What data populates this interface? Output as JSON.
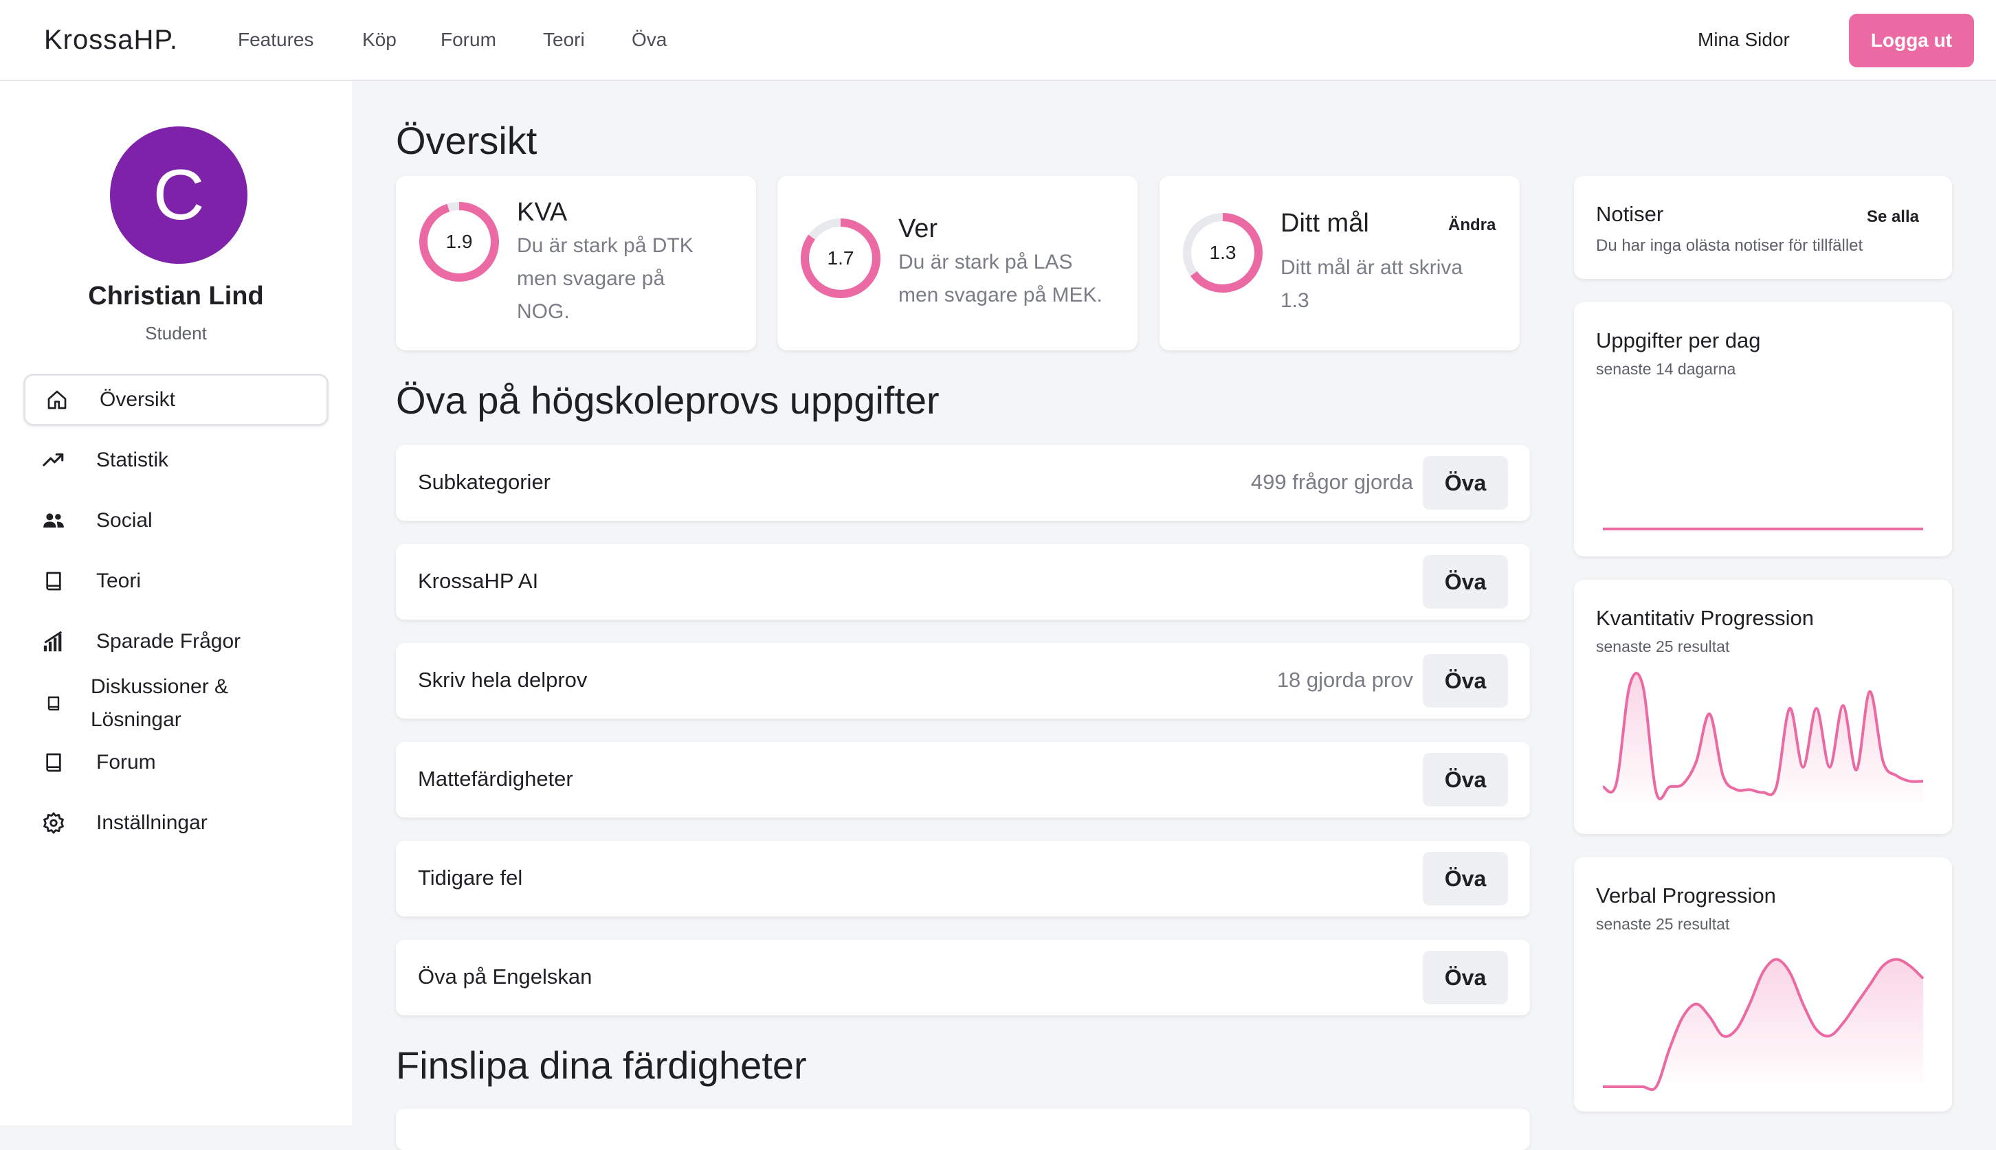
{
  "nav": {
    "brand": "KrossaHP.",
    "links": [
      "Features",
      "Köp",
      "Forum",
      "Teori",
      "Öva"
    ],
    "mina_sidor": "Mina Sidor",
    "logout": "Logga ut",
    "accent": "#ec6aa3"
  },
  "profile": {
    "initial": "C",
    "name": "Christian Lind",
    "role": "Student",
    "avatar_color": "#7e22a9"
  },
  "sidebar": {
    "items": [
      {
        "label": "Översikt",
        "icon": "home-icon",
        "active": true
      },
      {
        "label": "Statistik",
        "icon": "trending-up-icon"
      },
      {
        "label": "Social",
        "icon": "users-icon"
      },
      {
        "label": "Teori",
        "icon": "book-icon"
      },
      {
        "label": "Sparade Frågor",
        "icon": "signal-bars-icon"
      },
      {
        "label": "Diskussioner & Lösningar",
        "icon": "book-small-icon"
      },
      {
        "label": "Forum",
        "icon": "book-icon"
      },
      {
        "label": "Inställningar",
        "icon": "gear-icon"
      }
    ]
  },
  "main": {
    "overview_title": "Översikt",
    "stats": [
      {
        "title": "KVA",
        "value": "1.9",
        "fraction": 0.95,
        "desc_lines": [
          "Du är stark på DTK",
          "men svagare på",
          "NOG."
        ]
      },
      {
        "title": "Ver",
        "value": "1.7",
        "fraction": 0.85,
        "desc_lines": [
          "Du är stark på LAS",
          "men svagare på MEK."
        ]
      },
      {
        "title": "Ditt mål",
        "value": "1.3",
        "fraction": 0.65,
        "desc_lines": [
          "Ditt mål är att skriva",
          "1.3"
        ],
        "action": "Ändra"
      }
    ],
    "practice_title": "Öva på högskoleprovs uppgifter",
    "practice_rows": [
      {
        "label": "Subkategorier",
        "meta": "499 frågor gjorda",
        "button": "Öva"
      },
      {
        "label": "KrossaHP AI",
        "meta": "",
        "button": "Öva"
      },
      {
        "label": "Skriv hela delprov",
        "meta": "18 gjorda prov",
        "button": "Öva"
      },
      {
        "label": "Mattefärdigheter",
        "meta": "",
        "button": "Öva"
      },
      {
        "label": "Tidigare fel",
        "meta": "",
        "button": "Öva"
      },
      {
        "label": "Öva på Engelskan",
        "meta": "",
        "button": "Öva"
      }
    ],
    "skills_title": "Finslipa dina färdigheter"
  },
  "right": {
    "notices": {
      "title": "Notiser",
      "action": "Se alla",
      "text": "Du har inga olästa notiser för tillfället"
    },
    "per_day": {
      "title": "Uppgifter per dag",
      "subtitle": "senaste 14 dagarna"
    },
    "quant": {
      "title": "Kvantitativ Progression",
      "subtitle": "senaste 25 resultat"
    },
    "verbal": {
      "title": "Verbal Progression",
      "subtitle": "senaste 25 resultat"
    }
  },
  "chart_data": [
    {
      "type": "line",
      "title": "Uppgifter per dag",
      "x": [
        1,
        2,
        3,
        4,
        5,
        6,
        7,
        8,
        9,
        10,
        11,
        12,
        13,
        14
      ],
      "values": [
        0,
        0,
        0,
        0,
        0,
        0,
        0,
        0,
        0,
        0,
        0,
        0,
        0,
        0
      ],
      "ylim": [
        0,
        10
      ],
      "color": "#ec6aa3",
      "grid": false
    },
    {
      "type": "area",
      "title": "Kvantitativ Progression",
      "x": [
        1,
        2,
        3,
        4,
        5,
        6,
        7,
        8,
        9,
        10,
        11,
        12,
        13,
        14,
        15,
        16,
        17,
        18,
        19,
        20,
        21,
        22,
        23,
        24,
        25
      ],
      "values": [
        0.1,
        0.15,
        1.9,
        1.9,
        0,
        0.1,
        0.15,
        0.55,
        1.4,
        0.3,
        0.05,
        0.05,
        0.0,
        0.1,
        1.5,
        0.45,
        1.5,
        0.45,
        1.55,
        0.4,
        1.8,
        0.55,
        0.3,
        0.2,
        0.2
      ],
      "ylim": [
        -0.3,
        2.2
      ],
      "color": "#ec6aa3",
      "grid": false
    },
    {
      "type": "area",
      "title": "Verbal Progression",
      "x": [
        1,
        2,
        3,
        4,
        5,
        6,
        7,
        8,
        9,
        10,
        11,
        12,
        13,
        14,
        15,
        16,
        17,
        18,
        19,
        20,
        21,
        22,
        23,
        24,
        25
      ],
      "values": [
        0.0,
        0.0,
        0.0,
        0.0,
        0.0,
        0.6,
        1.1,
        1.3,
        1.1,
        0.8,
        0.9,
        1.3,
        1.8,
        2.0,
        1.8,
        1.3,
        0.9,
        0.8,
        1.0,
        1.3,
        1.6,
        1.9,
        2.0,
        1.9,
        1.7
      ],
      "ylim": [
        0,
        2.2
      ],
      "color": "#ec6aa3",
      "grid": false
    }
  ]
}
